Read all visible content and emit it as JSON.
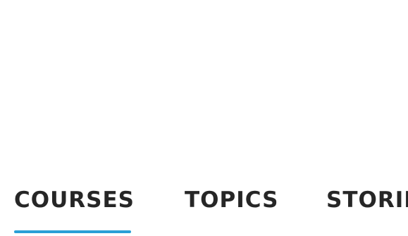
{
  "tabs": [
    {
      "label": "COURSES",
      "active": true
    },
    {
      "label": "TOPICS",
      "active": false
    },
    {
      "label": "STORIES",
      "active": false
    }
  ],
  "colors": {
    "text": "#262626",
    "active_indicator": "#2a9fd6",
    "background": "#ffffff"
  }
}
